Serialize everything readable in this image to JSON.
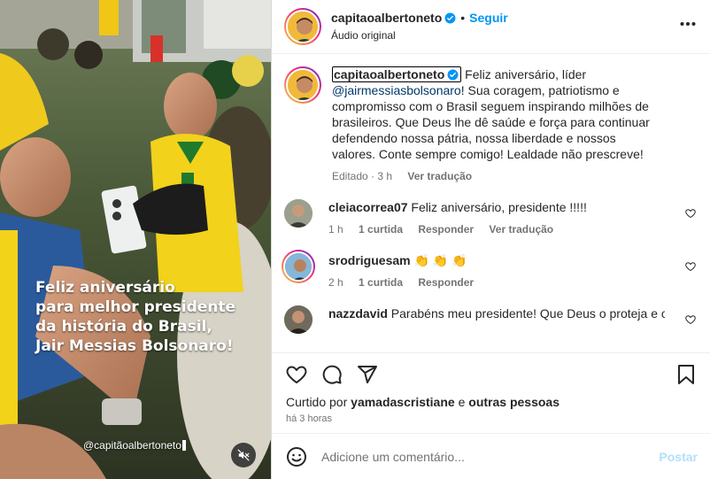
{
  "media": {
    "caption_lines": [
      "Feliz aniversário",
      "para melhor presidente",
      "da história do Brasil,",
      "Jair Messias Bolsonaro!"
    ],
    "watermark": "@capitãoalbertoneto",
    "mute_icon": "speaker-muted-icon"
  },
  "header": {
    "username": "capitaoalbertoneto",
    "dot": "•",
    "follow_label": "Seguir",
    "audio_label": "Áudio original",
    "more_icon": "more-horizontal-icon"
  },
  "post_caption": {
    "username": "capitaoalbertoneto",
    "text_before": "Feliz aniversário, líder",
    "mention": "@jairmessiasbolsonaro",
    "text_after": "! Sua coragem, patriotismo e compromisso com o Brasil seguem inspirando milhões de brasileiros. Que Deus lhe dê saúde e força para continuar defendendo nossa pátria, nossa liberdade e nossos valores. Conte sempre comigo! Lealdade não prescreve!",
    "edited": "Editado · 3 h",
    "translate": "Ver tradução"
  },
  "comments": [
    {
      "username": "cleiacorrea07",
      "text": "Feliz aniversário, presidente !!!!!",
      "time": "1 h",
      "likes": "1 curtida",
      "reply": "Responder",
      "translate": "Ver tradução"
    },
    {
      "username": "srodriguesam",
      "text": "👏 👏 👏",
      "time": "2 h",
      "likes": "1 curtida",
      "reply": "Responder"
    },
    {
      "username": "nazzdavid",
      "text": "Parabéns meu presidente! Que Deus o proteja e o"
    }
  ],
  "actions": {
    "icons": [
      "heart-icon",
      "comment-icon",
      "share-icon",
      "bookmark-icon"
    ],
    "liked_by_prefix": "Curtido por",
    "liked_by_user": "yamadascristiane",
    "liked_by_conj": "e",
    "liked_by_others": "outras pessoas",
    "time_ago": "há 3 horas"
  },
  "add_comment": {
    "placeholder": "Adicione um comentário...",
    "post_label": "Postar",
    "emoji_icon": "emoji-icon"
  },
  "colors": {
    "link_blue": "#0095f6",
    "mention_blue": "#00376b",
    "secondary_text": "#737373",
    "post_disabled": "#b2dffc"
  }
}
